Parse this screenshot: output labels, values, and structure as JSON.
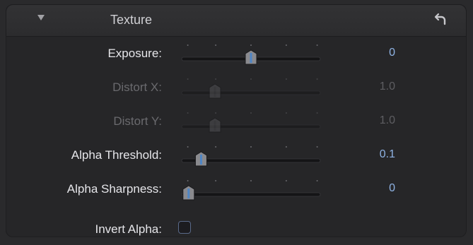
{
  "header": {
    "title": "Texture",
    "disclosure_icon": "disclosure-triangle-down-icon",
    "reset_icon": "reset-arrow-icon"
  },
  "params": [
    {
      "label": "Exposure:",
      "value": "0",
      "level": 0.5,
      "enabled": true
    },
    {
      "label": "Distort X:",
      "value": "1.0",
      "level": 0.24,
      "enabled": false
    },
    {
      "label": "Distort Y:",
      "value": "1.0",
      "level": 0.24,
      "enabled": false
    },
    {
      "label": "Alpha Threshold:",
      "value": "0.1",
      "level": 0.14,
      "enabled": true
    },
    {
      "label": "Alpha Sharpness:",
      "value": "0",
      "level": 0.05,
      "enabled": true
    }
  ],
  "invert": {
    "label": "Invert Alpha:",
    "checked": false
  },
  "colors": {
    "value_text": "#8fb3e4",
    "thumb_blue": "#4f86c6",
    "track": "#141416"
  }
}
